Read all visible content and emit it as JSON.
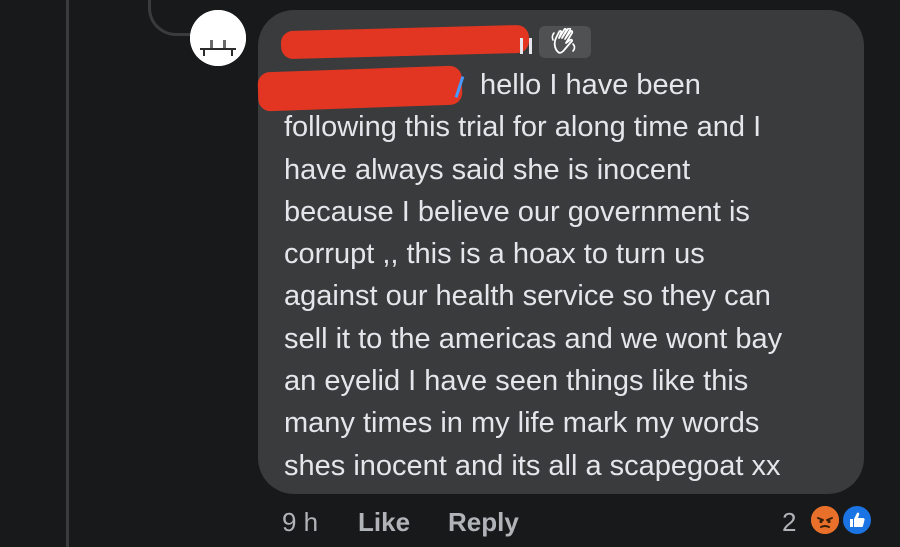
{
  "colors": {
    "background": "#18191a",
    "bubble": "#3a3b3c",
    "text": "#e4e6eb",
    "meta_text": "#b0b3b8",
    "redaction": "#e33622",
    "like_blue": "#1b74e4",
    "angry_orange": "#e8702a"
  },
  "comment": {
    "author_badge_icon": "waving-hand-icon",
    "body_lines": [
      "hello I have been",
      "following this trial for along time and I",
      "have always said she is inocent",
      "because I believe our government is",
      "corrupt ,, this is a hoax to turn us",
      "against our health service so they can",
      "sell it to the americas and we wont bay",
      "an eyelid I have seen things like this",
      "many times in my life mark my words",
      "shes inocent and its all a scapegoat xx"
    ]
  },
  "meta": {
    "time": "9 h",
    "like_label": "Like",
    "reply_label": "Reply",
    "reaction_count": "2",
    "reaction_icons": [
      "like-icon",
      "angry-icon"
    ]
  }
}
